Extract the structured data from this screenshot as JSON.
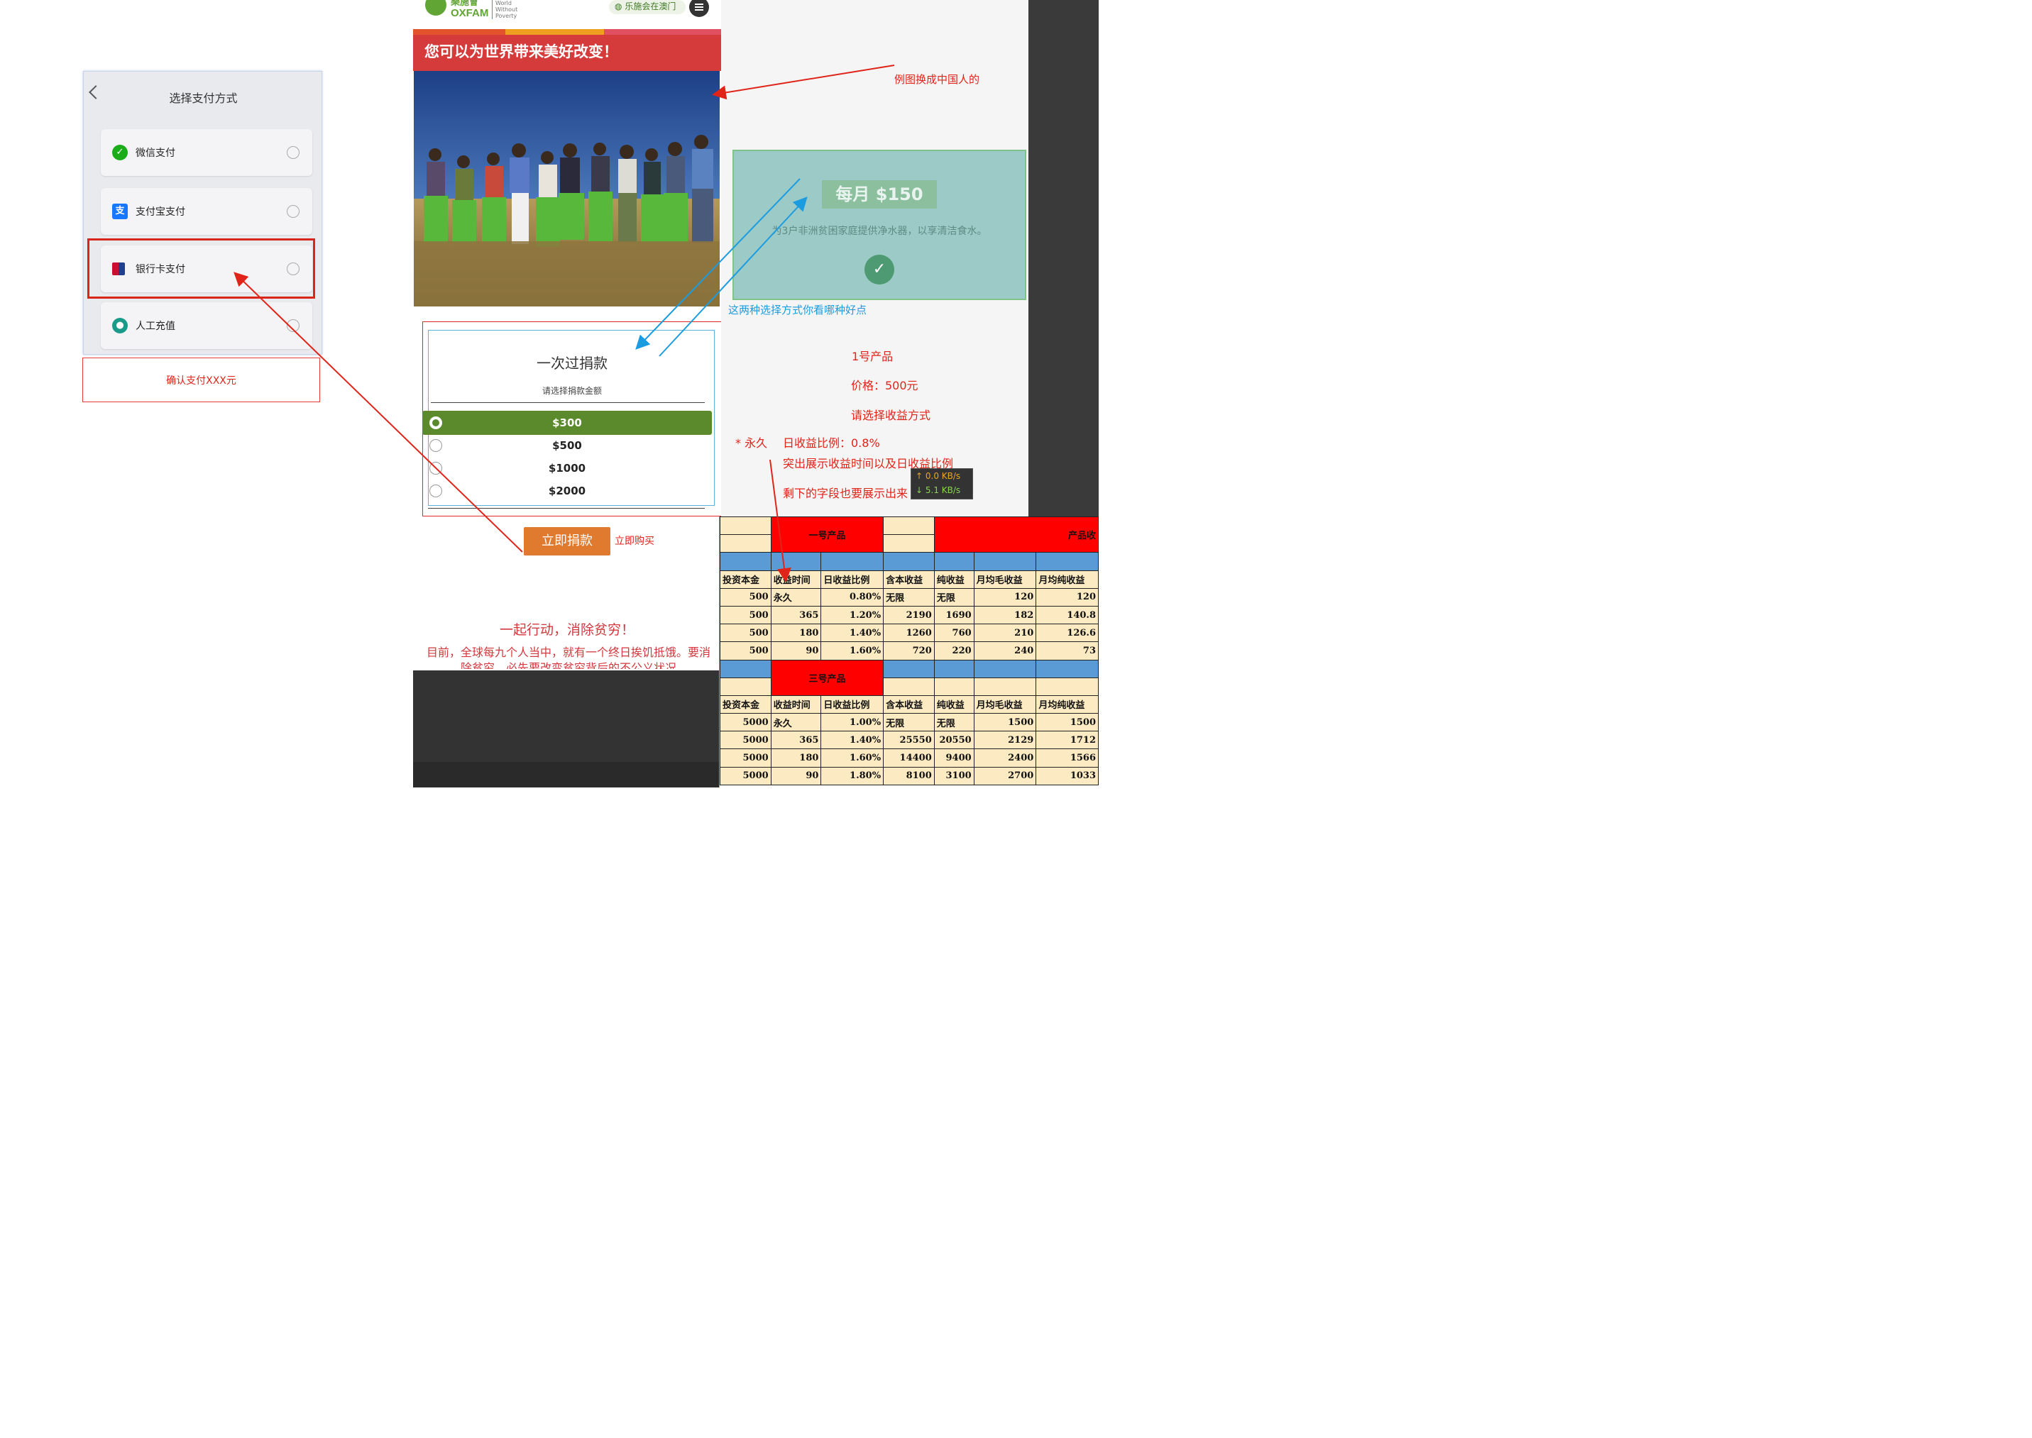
{
  "payment": {
    "title": "选择支付方式",
    "options": [
      {
        "label": "微信支付",
        "icon": "wechat-pay-icon",
        "color": "#1aad19"
      },
      {
        "label": "支付宝支付",
        "icon": "alipay-icon",
        "color": "#1677ff"
      },
      {
        "label": "银行卡支付",
        "icon": "bank-card-icon",
        "color": "#c8102e"
      },
      {
        "label": "人工充值",
        "icon": "manual-topup-icon",
        "color": "#1a9b8a"
      }
    ],
    "confirm_note": "确认支付XXX元"
  },
  "site": {
    "logo_cn": "樂施會",
    "logo_en": "OXFAM",
    "tagline": "Working for a World Without Poverty",
    "tagline_lines": [
      "World",
      "Without",
      "Poverty"
    ],
    "lang": "乐施会在澳门",
    "banner": "您可以为世界带来美好改变！",
    "photo_desc": "farmers-in-field"
  },
  "donate": {
    "heading": "一次过捐款",
    "sub": "请选择捐款金额",
    "amounts": [
      "$300",
      "$500",
      "$1000",
      "$2000"
    ],
    "selected_index": 0,
    "button": "立即捐款",
    "buy_now_note": "立即购买",
    "together": "一起行动，消除贫穷！",
    "body": "目前，全球每九个人当中，就有一个终日挨饥抵饿。要消除贫穷，必先要改变贫穷背后的不公义状况"
  },
  "monthly": {
    "amount": "每月 $150",
    "desc": "为3户非洲贫困家庭提供净水器，以享清洁食水。",
    "check_icon": "check-icon"
  },
  "annotations": {
    "replace_photo": "例图换成中国人的",
    "which_style": "这两种选择方式你看哪种好点",
    "product": "1号产品",
    "price": "价格：500元",
    "choose": "请选择收益方式",
    "forever_star": "* 永久",
    "daily_ratio": "日收益比例：0.8%",
    "highlight": "突出展示收益时间以及日收益比例",
    "rest_fields": "剩下的字段也要展示出来"
  },
  "net_speed": {
    "up": "↑ 0.0 KB/s",
    "down": "↓ 5.1 KB/s"
  },
  "sheet": {
    "product1_title": "一号产品",
    "product_right_title": "产品收",
    "product3_title": "三号产品",
    "headers": [
      "投资本金",
      "收益时间",
      "日收益比例",
      "含本收益",
      "纯收益",
      "月均毛收益",
      "月均纯收益"
    ],
    "rows1": [
      [
        "500",
        "永久",
        "0.80%",
        "无限",
        "无限",
        "120",
        "120"
      ],
      [
        "500",
        "365",
        "1.20%",
        "2190",
        "1690",
        "182",
        "140.8"
      ],
      [
        "500",
        "180",
        "1.40%",
        "1260",
        "760",
        "210",
        "126.6"
      ],
      [
        "500",
        "90",
        "1.60%",
        "720",
        "220",
        "240",
        "73"
      ]
    ],
    "rows3": [
      [
        "5000",
        "永久",
        "1.00%",
        "无限",
        "无限",
        "1500",
        "1500"
      ],
      [
        "5000",
        "365",
        "1.40%",
        "25550",
        "20550",
        "2129",
        "1712"
      ],
      [
        "5000",
        "180",
        "1.60%",
        "14400",
        "9400",
        "2400",
        "1566"
      ],
      [
        "5000",
        "90",
        "1.80%",
        "8100",
        "3100",
        "2700",
        "1033"
      ]
    ]
  }
}
